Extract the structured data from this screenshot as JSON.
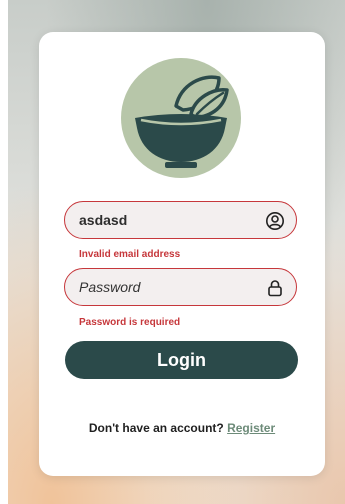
{
  "login_form": {
    "email": {
      "value": "asdasd",
      "error": "Invalid email address",
      "icon": "user-circle-icon"
    },
    "password": {
      "placeholder": "Password",
      "error": "Password is required",
      "icon": "lock-icon"
    },
    "login_label": "Login",
    "register_prompt": "Don't have an account?",
    "register_link": "Register"
  },
  "colors": {
    "logo_bg": "#b7c6a9",
    "logo_fg": "#2b4a4a",
    "error": "#c6373b",
    "primary_button": "#2b4a4a",
    "link": "#6d8b79"
  }
}
